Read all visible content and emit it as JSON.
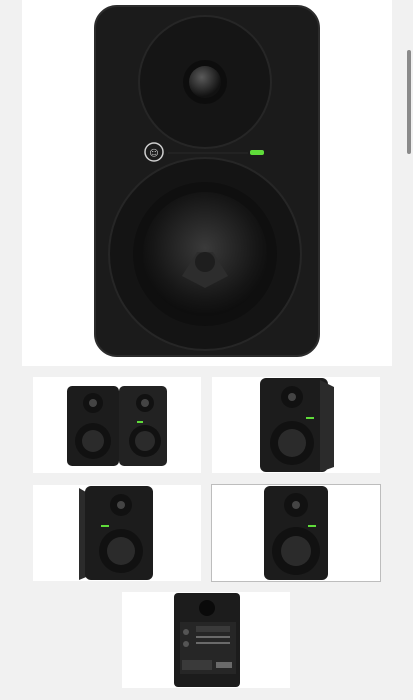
{
  "gallery": {
    "main_image": {
      "icon": "studio-monitor-front-image",
      "brand_logo": "mackie-logo-icon",
      "led_color": "#5fdc3a"
    },
    "thumbnails": [
      {
        "icon": "monitor-pair-image",
        "selected": false
      },
      {
        "icon": "monitor-angle-left-image",
        "selected": false
      },
      {
        "icon": "monitor-angle-right-image",
        "selected": false
      },
      {
        "icon": "monitor-front-image",
        "selected": true
      },
      {
        "icon": "monitor-rear-panel-image",
        "selected": false
      }
    ]
  },
  "colors": {
    "page_background": "#f1f1f1",
    "tile_background": "#ffffff",
    "cabinet": "#1b1b1b",
    "led": "#5fdc3a"
  }
}
